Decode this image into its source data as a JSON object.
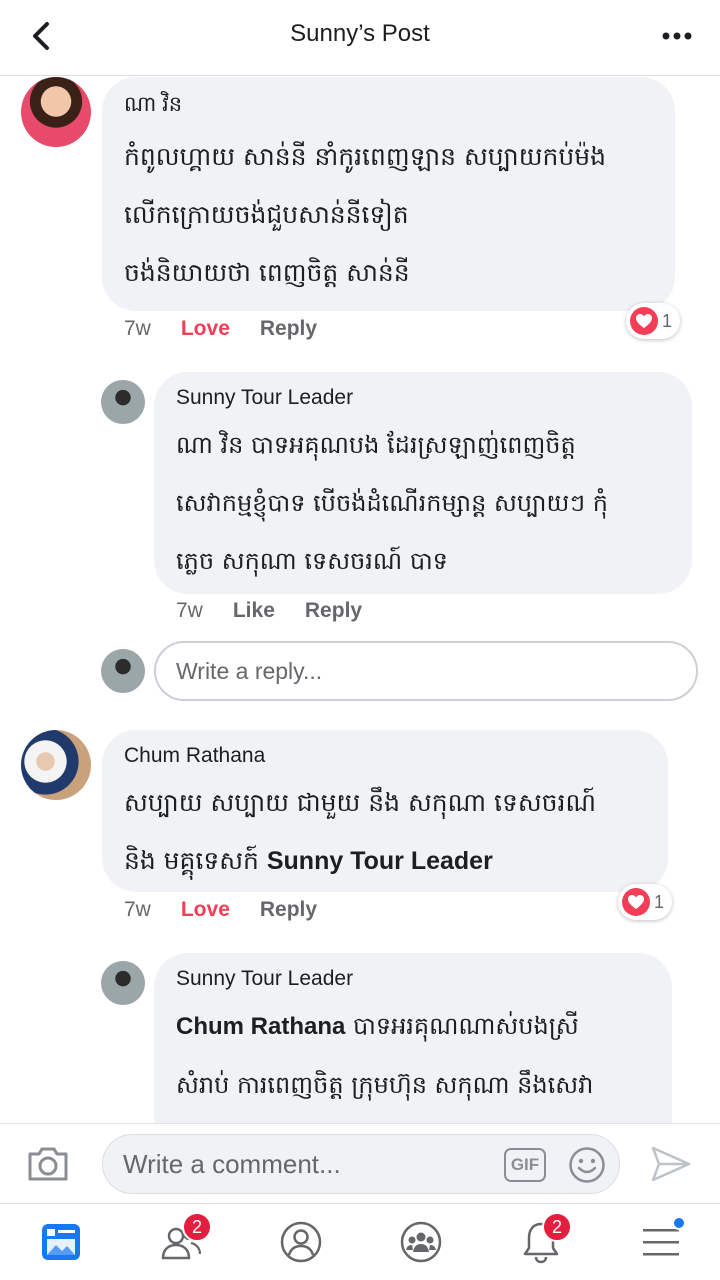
{
  "header": {
    "title": "Sunny’s Post",
    "back_icon": "chevron-left-icon",
    "more_icon": "more-horizontal-icon"
  },
  "comments": [
    {
      "author": "ណា វិន",
      "lines": [
        "កំពូលហ្គាយ សាន់នី នាំកូរពេញឡាន សប្បាយកប់ម៉ង",
        "លើកក្រោយចង់ជួបសាន់នីទៀត",
        "ចង់និយាយថា ពេញចិត្ត សាន់នី"
      ],
      "time": "7w",
      "reaction_label": "Love",
      "reply_label": "Reply",
      "reaction_count": "1"
    },
    {
      "author": "Sunny Tour Leader",
      "lines": [
        "ណា វិន បាទអគុណបង ដែរស្រឡាញ់ពេញចិត្ត",
        "សេវាកម្មខ្ញុំបាទ បើចង់ដំណើរកម្សាន្ត សប្បាយៗ កុំ",
        "ភ្លេច សកុណា ទេសចរណ៍ បាទ"
      ],
      "time": "7w",
      "like_label": "Like",
      "reply_label": "Reply"
    },
    {
      "author": "Chum Rathana",
      "lines": [
        "សប្បាយ សប្បាយ ជាមួយ នឹង សកុណា ទេសចរណ៍",
        "និង  មគ្គុទេសក៍ "
      ],
      "mention": "Sunny Tour Leader",
      "time": "7w",
      "reaction_label": "Love",
      "reply_label": "Reply",
      "reaction_count": "1"
    },
    {
      "author": "Sunny Tour Leader",
      "mention": "Chum Rathana",
      "lines": [
        " បាទអរគុណណាស់បងស្រី",
        "សំរាប់ ការពេញចិត្ត ក្រុមហ៊ុន សកុណា នឹងសេវា"
      ]
    }
  ],
  "reply_box": {
    "placeholder": "Write a reply..."
  },
  "composer": {
    "placeholder": "Write a comment...",
    "gif_label": "GIF",
    "camera_icon": "camera-icon",
    "emoji_icon": "smiley-icon",
    "send_icon": "send-icon"
  },
  "tabbar": {
    "items": [
      {
        "name": "news-feed-icon",
        "active": true
      },
      {
        "name": "friends-icon",
        "badge": "2"
      },
      {
        "name": "profile-icon"
      },
      {
        "name": "groups-icon"
      },
      {
        "name": "notifications-icon",
        "badge": "2"
      },
      {
        "name": "menu-icon",
        "dot": true
      }
    ]
  },
  "colors": {
    "accent": "#1877f2",
    "love": "#f33e58",
    "bubble": "#f0f2f5",
    "badge": "#e41e3f"
  }
}
